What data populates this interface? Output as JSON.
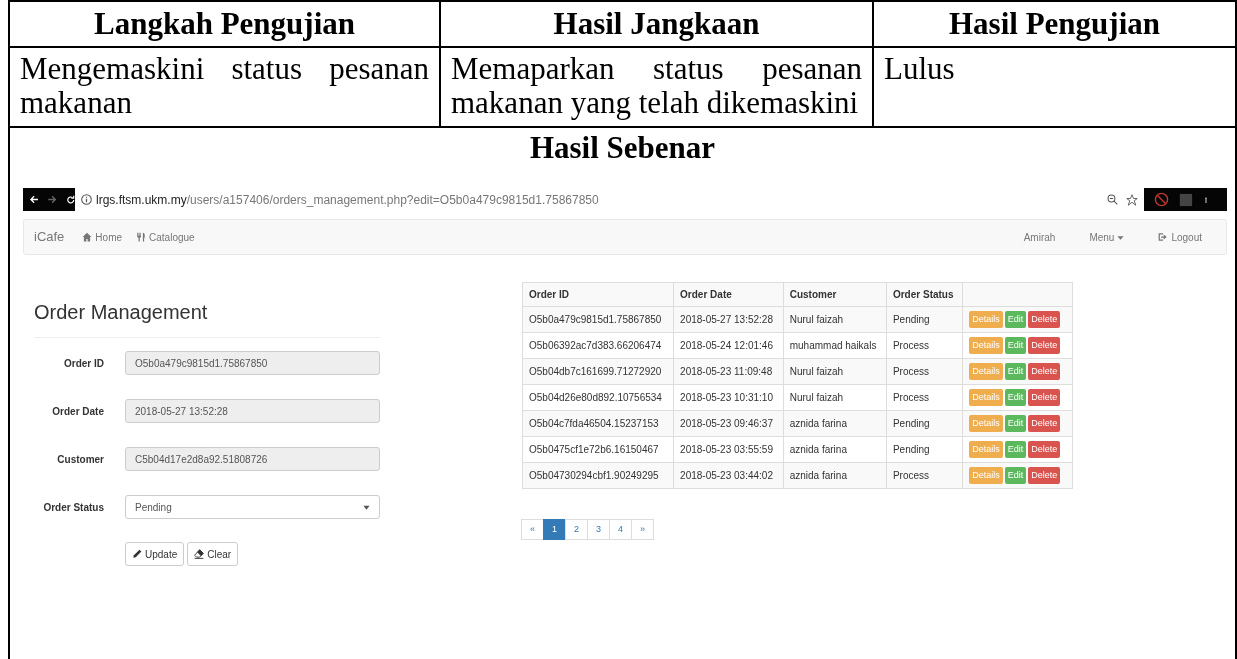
{
  "doc_table": {
    "columns": [
      "Langkah Pengujian",
      "Hasil Jangkaan",
      "Hasil Pengujian"
    ],
    "row": [
      "Mengemaskini status pesanan makanan",
      "Memaparkan status pesanan makanan yang telah dikemaskini",
      "Lulus"
    ],
    "result_title": "Hasil Sebenar"
  },
  "screenshot": {
    "browser": {
      "url_host": "lrgs.ftsm.ukm.my",
      "url_path": "/users/a157406/orders_management.php?edit=O5b0a479c9815d1.75867850"
    },
    "navbar": {
      "brand": "iCafe",
      "left_links": [
        {
          "label": "Home",
          "kind": "home"
        },
        {
          "label": "Catalogue",
          "kind": "cutlery"
        }
      ],
      "right_links": [
        {
          "label": "Amirah",
          "kind": "plain"
        },
        {
          "label": "Menu",
          "kind": "dropdown"
        },
        {
          "label": "Logout",
          "kind": "logout"
        }
      ]
    },
    "form": {
      "title": "Order Management",
      "fields": [
        {
          "label": "Order ID",
          "value": "O5b0a479c9815d1.75867850",
          "kind": "readonly"
        },
        {
          "label": "Order Date",
          "value": "2018-05-27 13:52:28",
          "kind": "readonly"
        },
        {
          "label": "Customer",
          "value": "C5b04d17e2d8a92.51808726",
          "kind": "readonly"
        },
        {
          "label": "Order Status",
          "value": "Pending",
          "kind": "select"
        }
      ],
      "buttons": [
        {
          "label": "Update",
          "kind": "pencil"
        },
        {
          "label": "Clear",
          "kind": "eraser"
        }
      ]
    },
    "orders": {
      "columns": [
        "Order ID",
        "Order Date",
        "Customer",
        "Order Status"
      ],
      "rows": [
        {
          "cells": [
            "O5b0a479c9815d1.75867850",
            "2018-05-27 13:52:28",
            "Nurul faizah",
            "Pending"
          ],
          "actions": [
            {
              "label": "Details",
              "kind": "warning"
            },
            {
              "label": "Edit",
              "kind": "success"
            },
            {
              "label": "Delete",
              "kind": "danger"
            }
          ]
        },
        {
          "cells": [
            "O5b06392ac7d383.66206474",
            "2018-05-24 12:01:46",
            "muhammad haikals",
            "Process"
          ],
          "actions": [
            {
              "label": "Details",
              "kind": "warning"
            },
            {
              "label": "Edit",
              "kind": "success"
            },
            {
              "label": "Delete",
              "kind": "danger"
            }
          ]
        },
        {
          "cells": [
            "O5b04db7c161699.71272920",
            "2018-05-23 11:09:48",
            "Nurul faizah",
            "Process"
          ],
          "actions": [
            {
              "label": "Details",
              "kind": "warning"
            },
            {
              "label": "Edit",
              "kind": "success"
            },
            {
              "label": "Delete",
              "kind": "danger"
            }
          ]
        },
        {
          "cells": [
            "O5b04d26e80d892.10756534",
            "2018-05-23 10:31:10",
            "Nurul faizah",
            "Process"
          ],
          "actions": [
            {
              "label": "Details",
              "kind": "warning"
            },
            {
              "label": "Edit",
              "kind": "success"
            },
            {
              "label": "Delete",
              "kind": "danger"
            }
          ]
        },
        {
          "cells": [
            "O5b04c7fda46504.15237153",
            "2018-05-23 09:46:37",
            "aznida farina",
            "Pending"
          ],
          "actions": [
            {
              "label": "Details",
              "kind": "warning"
            },
            {
              "label": "Edit",
              "kind": "success"
            },
            {
              "label": "Delete",
              "kind": "danger"
            }
          ]
        },
        {
          "cells": [
            "O5b0475cf1e72b6.16150467",
            "2018-05-23 03:55:59",
            "aznida farina",
            "Pending"
          ],
          "actions": [
            {
              "label": "Details",
              "kind": "warning"
            },
            {
              "label": "Edit",
              "kind": "success"
            },
            {
              "label": "Delete",
              "kind": "danger"
            }
          ]
        },
        {
          "cells": [
            "O5b04730294cbf1.90249295",
            "2018-05-23 03:44:02",
            "aznida farina",
            "Process"
          ],
          "actions": [
            {
              "label": "Details",
              "kind": "warning"
            },
            {
              "label": "Edit",
              "kind": "success"
            },
            {
              "label": "Delete",
              "kind": "danger"
            }
          ]
        }
      ]
    },
    "pagination": [
      {
        "label": "«",
        "selected": false
      },
      {
        "label": "1",
        "selected": true
      },
      {
        "label": "2",
        "selected": false
      },
      {
        "label": "3",
        "selected": false
      },
      {
        "label": "4",
        "selected": false
      },
      {
        "label": "»",
        "selected": false
      }
    ]
  }
}
